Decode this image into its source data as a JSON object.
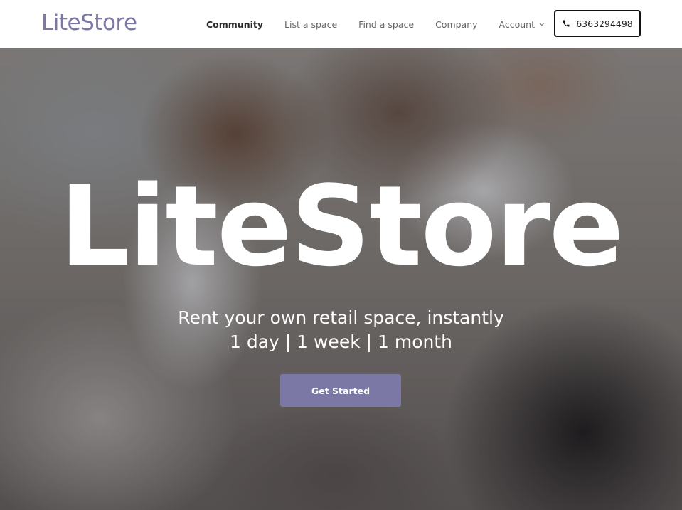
{
  "navbar": {
    "logo": "LiteStore",
    "links": [
      {
        "label": "Community",
        "active": true
      },
      {
        "label": "List a space",
        "active": false
      },
      {
        "label": "Find a space",
        "active": false
      },
      {
        "label": "Company",
        "active": false
      },
      {
        "label": "Account",
        "active": false,
        "has_dropdown": true
      }
    ],
    "phone": {
      "icon": "phone-icon",
      "number": "6363294498"
    }
  },
  "hero": {
    "title": "LiteStore",
    "subtitle": "Rent your own retail space, instantly",
    "durations": "1 day | 1 week | 1 month",
    "cta_label": "Get Started"
  },
  "colors": {
    "brand": "#7b78a6",
    "nav_text": "#666666",
    "nav_active": "#2a2a2a",
    "hero_text": "#ffffff"
  }
}
